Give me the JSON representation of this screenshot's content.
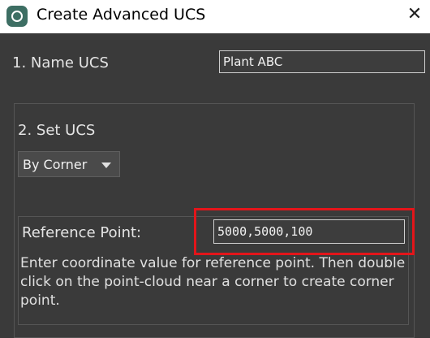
{
  "window": {
    "title": "Create Advanced UCS",
    "close_glyph": "✕",
    "app_icon": "app-icon"
  },
  "name_section": {
    "label": "1. Name UCS",
    "value": "Plant ABC"
  },
  "set_section": {
    "label": "2. Set UCS",
    "method_selected": "By Corner"
  },
  "reference": {
    "label": "Reference Point:",
    "value": "5000,5000,100",
    "help_text": "Enter coordinate value for reference point. Then double click on the point-cloud near a corner to create corner point."
  },
  "colors": {
    "background": "#3a3a3a",
    "highlight": "#e3151a",
    "titlebar": "#ffffff"
  }
}
